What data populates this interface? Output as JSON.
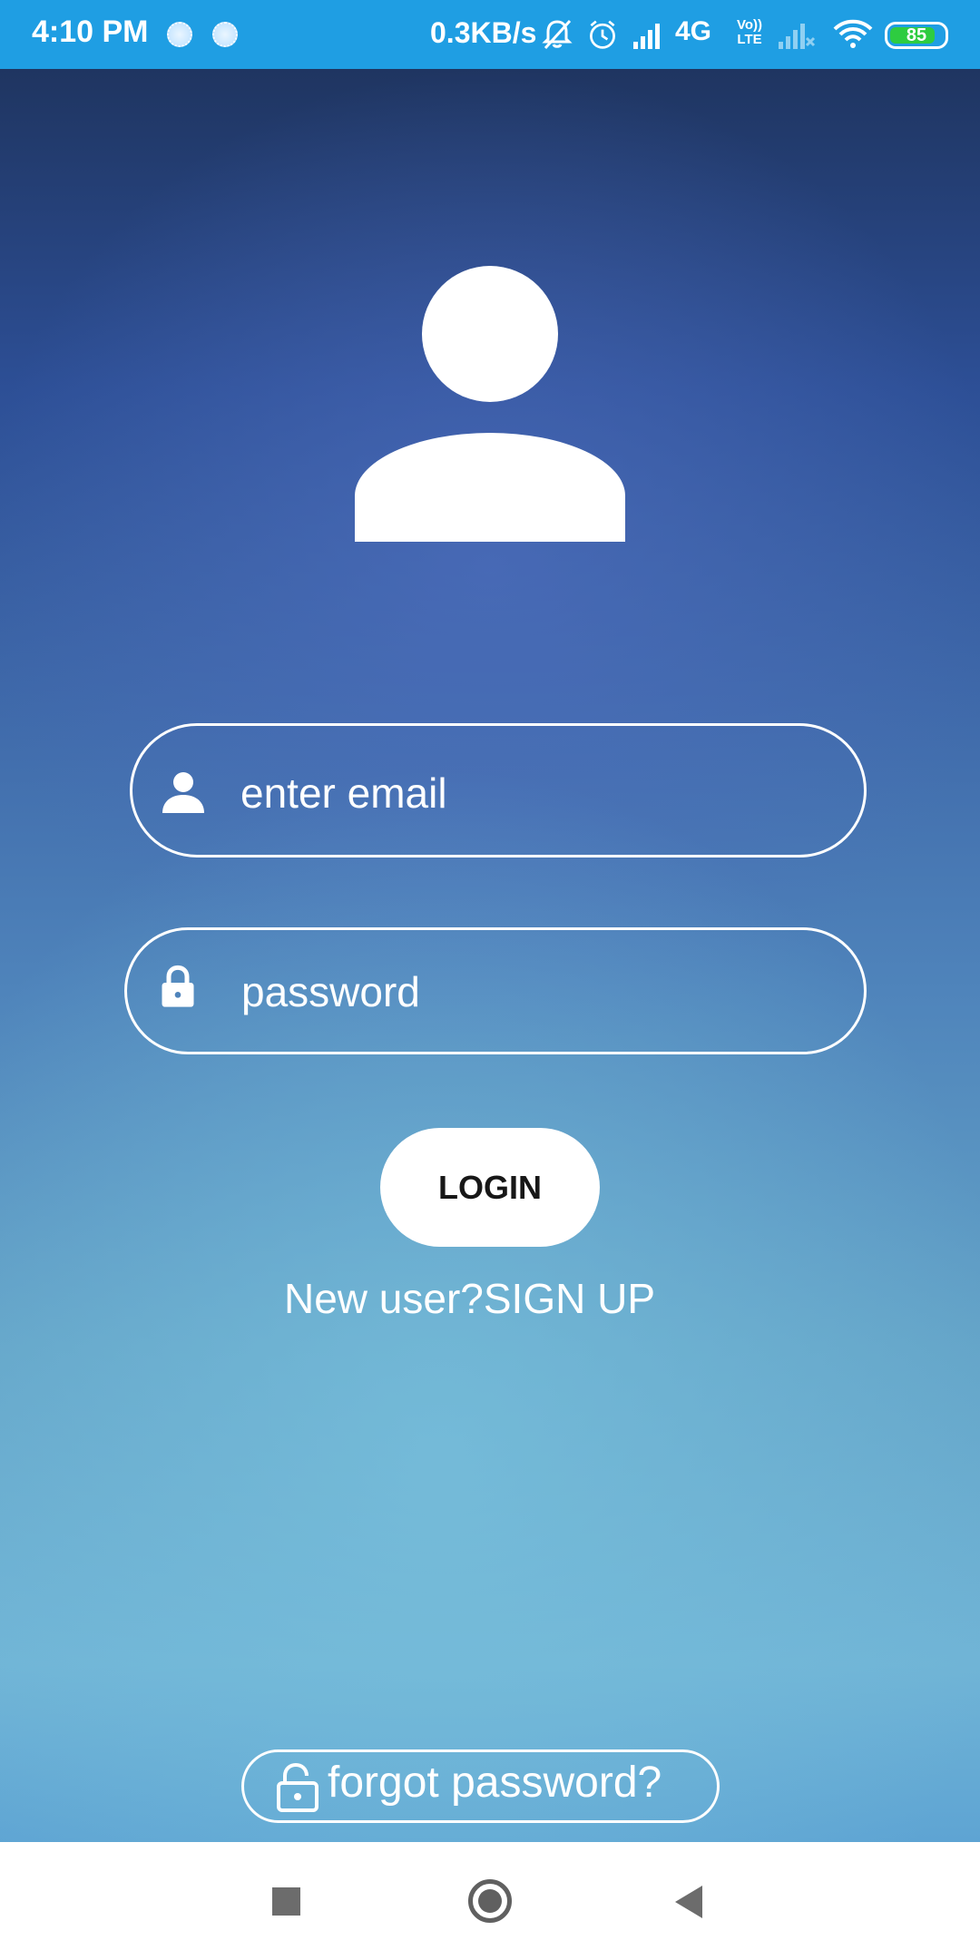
{
  "status_bar": {
    "time": "4:10 PM",
    "network_speed": "0.3KB/s",
    "network_type": "4G",
    "volte_line1": "Vo))",
    "volte_line2": "LTE",
    "battery_level": "85",
    "battery_fraction": 0.85,
    "background_color": "#1f9ee3"
  },
  "login": {
    "avatar_icon": "person-icon",
    "email_icon": "person-icon",
    "email_placeholder": "enter email",
    "password_icon": "lock-icon",
    "password_placeholder": "password",
    "login_button_label": "LOGIN",
    "signup_text": "New user?SIGN UP",
    "forgot_icon": "unlock-icon",
    "forgot_password_label": "forgot password?"
  },
  "nav_bar": {
    "recents_icon": "square-icon",
    "home_icon": "circle-icon",
    "back_icon": "triangle-back-icon"
  }
}
